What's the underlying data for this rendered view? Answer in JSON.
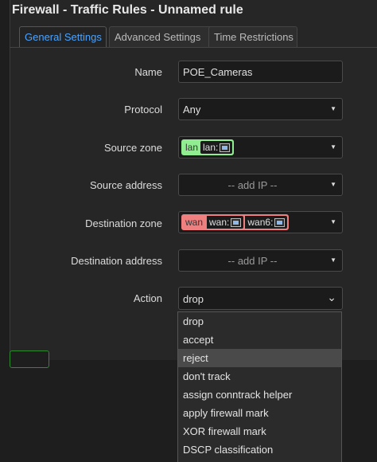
{
  "window": {
    "title": "Firewall - Traffic Rules - Unnamed rule"
  },
  "tabs": [
    {
      "label": "General Settings",
      "active": true
    },
    {
      "label": "Advanced Settings",
      "active": false
    },
    {
      "label": "Time Restrictions",
      "active": false
    }
  ],
  "form": {
    "name": {
      "label": "Name",
      "value": "POE_Cameras"
    },
    "protocol": {
      "label": "Protocol",
      "value": "Any"
    },
    "source_zone": {
      "label": "Source zone",
      "zone": "lan",
      "devices": [
        "lan:"
      ],
      "color": "#90ee90"
    },
    "source_address": {
      "label": "Source address",
      "placeholder": "-- add IP --"
    },
    "destination_zone": {
      "label": "Destination zone",
      "zone": "wan",
      "devices": [
        "wan:",
        "wan6:"
      ],
      "color": "#f08080"
    },
    "destination_address": {
      "label": "Destination address",
      "placeholder": "-- add IP --"
    },
    "action": {
      "label": "Action",
      "value": "drop",
      "options": [
        "drop",
        "accept",
        "reject",
        "don't track",
        "assign conntrack helper",
        "apply firewall mark",
        "XOR firewall mark",
        "DSCP classification"
      ],
      "highlighted": "reject"
    }
  },
  "icons": {
    "network": "network-interface-icon",
    "caret": "caret-down-icon",
    "chevron": "chevron-down-icon"
  },
  "colors": {
    "accent": "#4aa3ff",
    "lan": "#90ee90",
    "wan": "#f08080"
  }
}
